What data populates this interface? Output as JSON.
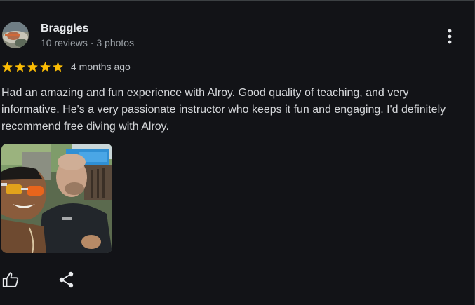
{
  "review": {
    "reviewer_name": "Braggles",
    "reviewer_meta": "10 reviews · 3 photos",
    "rating": 5,
    "rating_max": 5,
    "date": "4 months ago",
    "text": "Had an amazing and fun experience with Alroy. Good quality of teaching, and very informative. He's a very passionate instructor who keeps it fun and engaging. I'd definitely recommend free diving with Alroy.",
    "star_color": "#fbbc04",
    "photo_count": 1
  },
  "icons": {
    "more": "more-vert-icon",
    "like": "thumb-up-icon",
    "share": "share-icon"
  },
  "colors": {
    "background": "#121317",
    "text_primary": "#e8eaed",
    "text_secondary": "#9aa0a6"
  }
}
